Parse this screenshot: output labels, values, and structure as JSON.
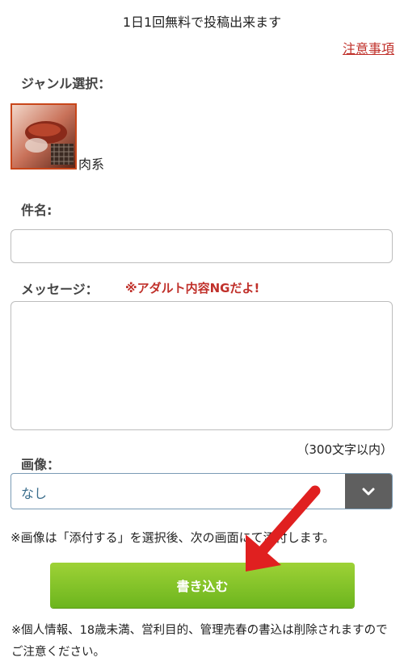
{
  "header": {
    "free_note": "1日1回無料で投稿出来ます",
    "caution_link": "注意事項"
  },
  "genre": {
    "label": "ジャンル選択：",
    "selected": "肉系",
    "icon": "meat-photo"
  },
  "subject": {
    "label": "件名:",
    "value": "",
    "placeholder": ""
  },
  "message": {
    "label": "メッセージ：",
    "warning": "※アダルト内容NGだよ!",
    "value": "",
    "char_limit": "（300文字以内）"
  },
  "image": {
    "label": "画像：",
    "selected": "なし",
    "note": "※画像は「添付する」を選択後、次の画面にて添付します。"
  },
  "submit": {
    "label": "書き込む"
  },
  "footer": {
    "privacy_note": "※個人情報、18歳未満、営利目的、管理売春の書込は削除されますのでご注意ください。"
  },
  "colors": {
    "accent_red": "#c0302a",
    "button_green": "#7dc226",
    "select_arrow_bg": "#5f5f5f"
  }
}
